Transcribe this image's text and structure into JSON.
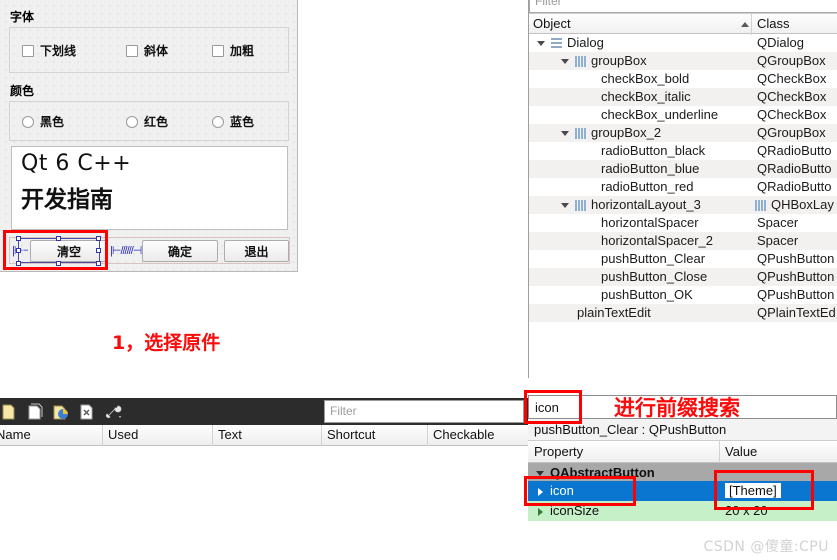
{
  "form": {
    "font_group_title": "字体",
    "checkboxes": [
      {
        "label": "下划线",
        "checked": false
      },
      {
        "label": "斜体",
        "checked": false
      },
      {
        "label": "加粗",
        "checked": false
      }
    ],
    "color_group_title": "颜色",
    "radios": [
      {
        "label": "黑色",
        "checked": false
      },
      {
        "label": "红色",
        "checked": false
      },
      {
        "label": "蓝色",
        "checked": false
      }
    ],
    "textedit": {
      "line1": "Qt 6 C++",
      "line2": "开发指南"
    },
    "buttons": [
      {
        "label": "清空",
        "selected": true
      },
      {
        "label": "确定",
        "selected": false
      },
      {
        "label": "退出",
        "selected": false
      }
    ]
  },
  "annotations": {
    "step1": "1，选择原件",
    "step2": "进行前缀搜索"
  },
  "inspector": {
    "filter_placeholder": "Filter",
    "columns": [
      "Object",
      "Class"
    ],
    "sort_indicator": "ascending",
    "rows": [
      {
        "object": "Dialog",
        "class": "QDialog",
        "indent": 0,
        "expander": "down",
        "icon": "dialog-icon"
      },
      {
        "object": "groupBox",
        "class": "QGroupBox",
        "indent": 1,
        "expander": "down",
        "icon": "hbox-icon"
      },
      {
        "object": "checkBox_bold",
        "class": "QCheckBox",
        "indent": 2,
        "expander": "",
        "icon": ""
      },
      {
        "object": "checkBox_italic",
        "class": "QCheckBox",
        "indent": 2,
        "expander": "",
        "icon": ""
      },
      {
        "object": "checkBox_underline",
        "class": "QCheckBox",
        "indent": 2,
        "expander": "",
        "icon": ""
      },
      {
        "object": "groupBox_2",
        "class": "QGroupBox",
        "indent": 1,
        "expander": "down",
        "icon": "hbox-icon"
      },
      {
        "object": "radioButton_black",
        "class": "QRadioButto",
        "indent": 2,
        "expander": "",
        "icon": ""
      },
      {
        "object": "radioButton_blue",
        "class": "QRadioButto",
        "indent": 2,
        "expander": "",
        "icon": ""
      },
      {
        "object": "radioButton_red",
        "class": "QRadioButto",
        "indent": 2,
        "expander": "",
        "icon": ""
      },
      {
        "object": "horizontalLayout_3",
        "class": "QHBoxLay",
        "indent": 1,
        "expander": "down",
        "icon": "hbox-icon",
        "class_icon": "hbox-icon"
      },
      {
        "object": "horizontalSpacer",
        "class": "Spacer",
        "indent": 2,
        "expander": "",
        "icon": ""
      },
      {
        "object": "horizontalSpacer_2",
        "class": "Spacer",
        "indent": 2,
        "expander": "",
        "icon": ""
      },
      {
        "object": "pushButton_Clear",
        "class": "QPushButton",
        "indent": 2,
        "expander": "",
        "icon": ""
      },
      {
        "object": "pushButton_Close",
        "class": "QPushButton",
        "indent": 2,
        "expander": "",
        "icon": ""
      },
      {
        "object": "pushButton_OK",
        "class": "QPushButton",
        "indent": 2,
        "expander": "",
        "icon": ""
      },
      {
        "object": "plainTextEdit",
        "class": "QPlainTextEd",
        "indent": 1,
        "expander": "",
        "icon": ""
      }
    ]
  },
  "action_editor": {
    "toolbar_icons": [
      "new-action-icon",
      "copy-action-icon",
      "edit-action-icon",
      "delete-action-icon",
      "configure-icon"
    ],
    "filter_placeholder": "Filter",
    "columns": [
      "Name",
      "Used",
      "Text",
      "Shortcut",
      "Checkable"
    ]
  },
  "property_editor": {
    "filter_value": "icon",
    "object_label": "pushButton_Clear : QPushButton",
    "columns": [
      "Property",
      "Value"
    ],
    "rows": [
      {
        "name": "QAbstractButton",
        "value": "",
        "kind": "group"
      },
      {
        "name": "icon",
        "value": "[Theme]",
        "kind": "selected"
      },
      {
        "name": "iconSize",
        "value": "20 x 20",
        "kind": "modified"
      }
    ]
  },
  "watermark": "CSDN @傻童:CPU",
  "colors": {
    "annotation_red": "#fb0a0a",
    "selection_blue": "#0b76d0",
    "modified_green": "#c6f0c8",
    "toolbar_dark": "#2c2c2c"
  }
}
